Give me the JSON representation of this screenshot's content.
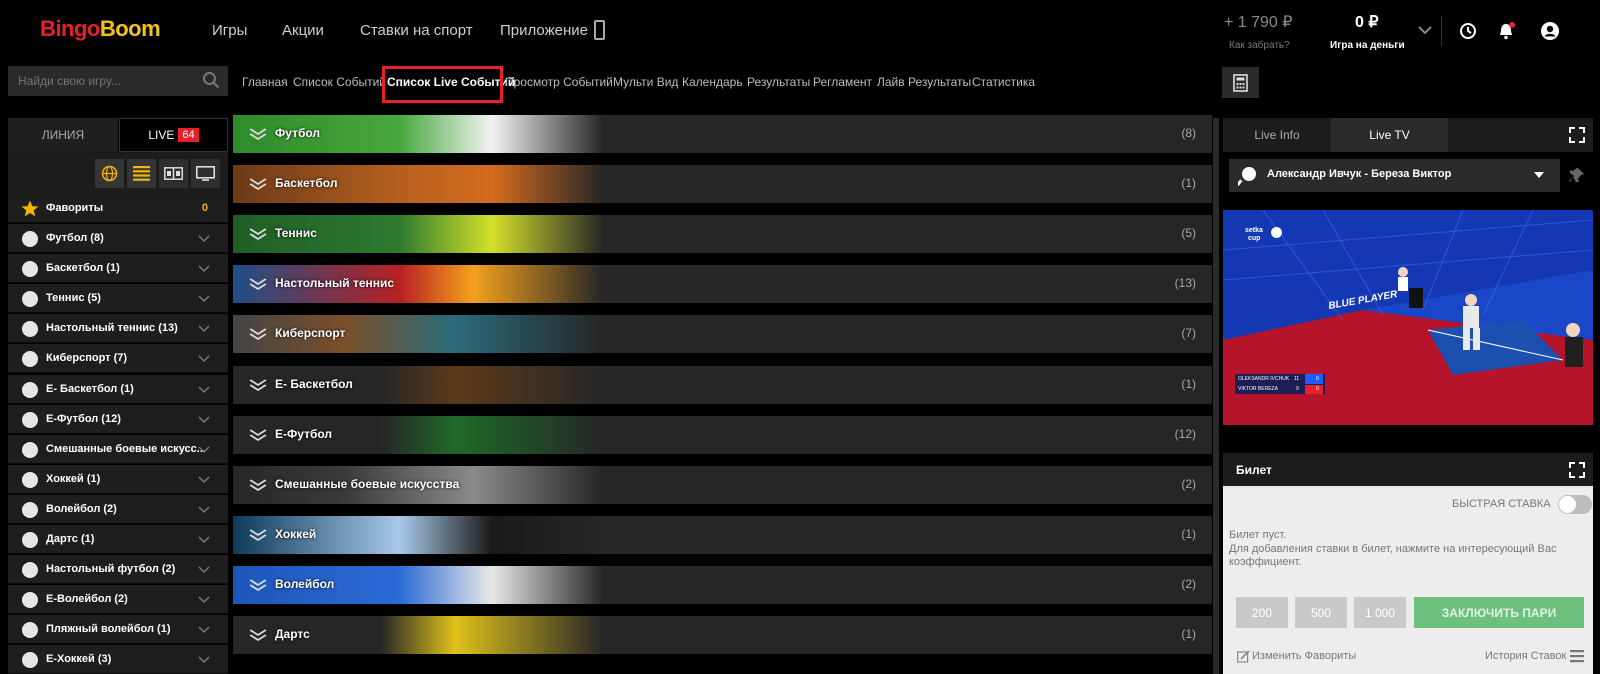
{
  "header": {
    "logo_part1": "Bingo",
    "logo_part2": "Boom",
    "nav": [
      "Игры",
      "Акции",
      "Ставки на спорт",
      "Приложение"
    ],
    "bonus_balance": "+ 1 790 ₽",
    "bonus_link": "Как забрать?",
    "money_balance": "0 ₽",
    "money_label": "Игра на деньги",
    "icons": [
      "chevron-down-icon",
      "history-icon",
      "bell-icon",
      "user-icon"
    ]
  },
  "search": {
    "placeholder": "Найди свою игру..."
  },
  "subnav": [
    "Главная",
    "Список Событий",
    "Список Live Событий",
    "Просмотр Событий",
    "Мульти Вид",
    "Календарь",
    "Результаты",
    "Регламент",
    "Лайв Результаты",
    "Статистика"
  ],
  "subnav_active": "Список Live Событий",
  "left": {
    "tab_line": "ЛИНИЯ",
    "tab_live": "LIVE",
    "live_count": "64",
    "filters": [
      "globe-icon",
      "list-icon",
      "scoreboard-icon",
      "tv-icon"
    ],
    "favorites_label": "Фавориты",
    "favorites_count": "0",
    "sports": [
      "Футбол (8)",
      "Баскетбол (1)",
      "Теннис (5)",
      "Настольный теннис (13)",
      "Киберспорт (7)",
      "E- Баскетбол (1)",
      "E-Футбол (12)",
      "Смешанные боевые искусс...",
      "Хоккей (1)",
      "Волейбол (2)",
      "Дартс (1)",
      "Настольный футбол (2)",
      "E-Волейбол (2)",
      "Пляжный волейбол (1)",
      "E-Хоккей (3)"
    ]
  },
  "center": {
    "rows": [
      {
        "label": "Футбол",
        "count": "(8)"
      },
      {
        "label": "Баскетбол",
        "count": "(1)"
      },
      {
        "label": "Теннис",
        "count": "(5)"
      },
      {
        "label": "Настольный теннис",
        "count": "(13)"
      },
      {
        "label": "Киберспорт",
        "count": "(7)"
      },
      {
        "label": "E- Баскетбол",
        "count": "(1)"
      },
      {
        "label": "E-Футбол",
        "count": "(12)"
      },
      {
        "label": "Смешанные боевые искусства",
        "count": "(2)"
      },
      {
        "label": "Хоккей",
        "count": "(1)"
      },
      {
        "label": "Волейбол",
        "count": "(2)"
      },
      {
        "label": "Дартс",
        "count": "(1)"
      }
    ]
  },
  "right": {
    "tab_info": "Live Info",
    "tab_tv": "Live TV",
    "match": "Александр Ивчук - Береза Виктор",
    "video": {
      "brand_line1": "setka",
      "brand_line2": "cup",
      "banner": "BLUE PLAYER",
      "player1": "OLEKSANDR IVCHUK",
      "player1_score": "11",
      "player1_pts": "0",
      "player2": "VIKTOR BEREZA",
      "player2_score": "9",
      "player2_pts": "0"
    },
    "betslip_title": "Билет",
    "quick_bet": "БЫСТРАЯ СТАВКА",
    "empty_line1": "Билет пуст.",
    "empty_line2": "Для добавления ставки в билет, нажмите на интересующий Вас коэффициент.",
    "stakes": [
      "200",
      "500",
      "1 000"
    ],
    "confirm": "ЗАКЛЮЧИТЬ ПАРИ",
    "edit_favorites": "Изменить Фавориты",
    "bet_history": "История Ставок"
  }
}
